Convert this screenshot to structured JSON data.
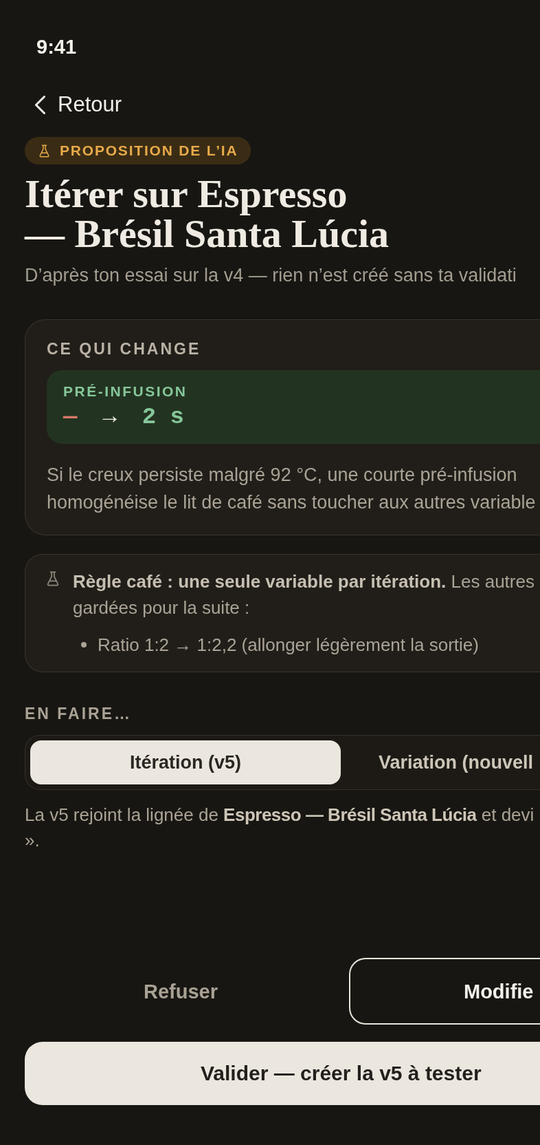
{
  "status_bar": {
    "time": "9:41"
  },
  "nav": {
    "back_label": "Retour"
  },
  "header": {
    "badge": "PROPOSITION DE L’IA",
    "title": "Itérer sur Espresso — Brésil Santa Lúcia",
    "subtitle": "D’après ton essai sur la v4 — rien n’est créé sans ta validati"
  },
  "change_card": {
    "heading": "CE QUI CHANGE",
    "changes": [
      {
        "parameter": "PRÉ-INFUSION",
        "old_value": "—",
        "arrow": "→",
        "new_value": "2 s"
      }
    ],
    "explanation_lines": [
      "Si le creux persiste malgré 92 °C, une courte pré-infusion",
      "homogénéise le lit de café sans toucher aux autres variable"
    ]
  },
  "rule_note": {
    "text_lines": [
      "**Règle café : une seule variable par itération.** Les autres",
      "gardées pour la suite :"
    ],
    "items": [
      "Ratio 1:2 → 1:2,2 (allonger légèrement la sortie)"
    ]
  },
  "destination": {
    "heading": "EN FAIRE…",
    "options": [
      {
        "label": "Itération (v5)",
        "selected": true
      },
      {
        "label": "Variation (nouvell",
        "selected": false
      }
    ],
    "description_lines": [
      "La v5 rejoint la lignée de **Espresso — Brésil Santa Lúcia** et devi",
      "»."
    ]
  },
  "actions": [
    {
      "kind": "text",
      "label": "Refuser"
    },
    {
      "kind": "outline",
      "label": "Modifie"
    },
    {
      "kind": "primary",
      "label": "Valider — créer la v5 à tester"
    }
  ]
}
